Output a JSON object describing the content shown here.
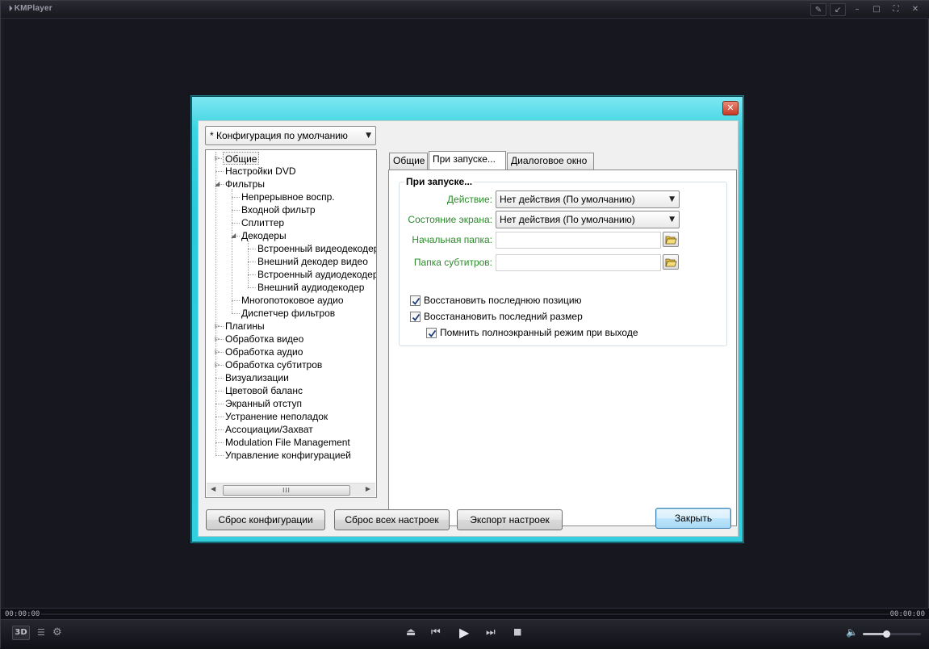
{
  "player": {
    "title": "KMPlayer",
    "time_elapsed": "00:00:00",
    "time_total": "00:00:00",
    "badge_3d": "3D",
    "volume_level": 0.4
  },
  "icons": {
    "player_logo": "kmplayer-logo-icon",
    "pin": "pin-icon",
    "compact": "compact-mode-icon",
    "minimize": "minimize-icon",
    "maximize": "maximize-icon",
    "fullscreen": "fullscreen-icon",
    "close": "close-icon",
    "playlist": "playlist-icon",
    "settings": "gear-icon",
    "eject": "eject-icon",
    "previous": "previous-icon",
    "play": "play-icon",
    "next": "next-icon",
    "stop": "stop-icon",
    "volume": "speaker-icon",
    "folder": "folder-open-icon"
  },
  "dialog": {
    "config_select": "* Конфигурация по умолчанию",
    "tree": [
      {
        "label": "Общие",
        "level": 0,
        "expander": "collapsed",
        "selected": true
      },
      {
        "label": "Настройки DVD",
        "level": 0,
        "expander": "none"
      },
      {
        "label": "Фильтры",
        "level": 0,
        "expander": "expanded"
      },
      {
        "label": "Непрерывное воспр.",
        "level": 1,
        "expander": "none"
      },
      {
        "label": "Входной фильтр",
        "level": 1,
        "expander": "none"
      },
      {
        "label": "Сплиттер",
        "level": 1,
        "expander": "none"
      },
      {
        "label": "Декодеры",
        "level": 1,
        "expander": "expanded"
      },
      {
        "label": "Встроенный видеодекодер",
        "level": 2,
        "expander": "none"
      },
      {
        "label": "Внешний декодер видео",
        "level": 2,
        "expander": "none"
      },
      {
        "label": "Встроенный аудиодекодер",
        "level": 2,
        "expander": "none"
      },
      {
        "label": "Внешний аудиодекодер",
        "level": 2,
        "expander": "none"
      },
      {
        "label": "Многопотоковое аудио",
        "level": 1,
        "expander": "none"
      },
      {
        "label": "Диспетчер фильтров",
        "level": 1,
        "expander": "none"
      },
      {
        "label": "Плагины",
        "level": 0,
        "expander": "collapsed"
      },
      {
        "label": "Обработка видео",
        "level": 0,
        "expander": "collapsed"
      },
      {
        "label": "Обработка аудио",
        "level": 0,
        "expander": "collapsed"
      },
      {
        "label": "Обработка субтитров",
        "level": 0,
        "expander": "collapsed"
      },
      {
        "label": "Визуализации",
        "level": 0,
        "expander": "none"
      },
      {
        "label": "Цветовой баланс",
        "level": 0,
        "expander": "none"
      },
      {
        "label": "Экранный отступ",
        "level": 0,
        "expander": "none"
      },
      {
        "label": "Устранение неполадок",
        "level": 0,
        "expander": "none"
      },
      {
        "label": "Ассоциации/Захват",
        "level": 0,
        "expander": "none"
      },
      {
        "label": "Modulation File Management",
        "level": 0,
        "expander": "none"
      },
      {
        "label": "Управление конфигурацией",
        "level": 0,
        "expander": "none"
      }
    ],
    "scroll_thumb_label": "III",
    "tabs": [
      {
        "label": "Общие",
        "active": false
      },
      {
        "label": "При запуске...",
        "active": true
      },
      {
        "label": "Диалоговое окно",
        "active": false
      }
    ],
    "group_title": "При запуске...",
    "fields": {
      "action_label": "Действие:",
      "action_value": "Нет действия (По умолчанию)",
      "screen_state_label": "Состояние экрана:",
      "screen_state_value": "Нет действия (По умолчанию)",
      "start_folder_label": "Начальная папка:",
      "start_folder_value": "",
      "subtitle_folder_label": "Папка субтитров:",
      "subtitle_folder_value": ""
    },
    "checkboxes": [
      {
        "label": "Восстановить последнюю позицию",
        "checked": true
      },
      {
        "label": "Восстанановить последний размер",
        "checked": true
      },
      {
        "label": "Помнить полноэкранный режим при выходе",
        "checked": true
      }
    ],
    "buttons": {
      "reset_config": "Сброс конфигурации",
      "reset_all": "Сброс всех настроек",
      "export": "Экспорт настроек",
      "close": "Закрыть"
    }
  }
}
